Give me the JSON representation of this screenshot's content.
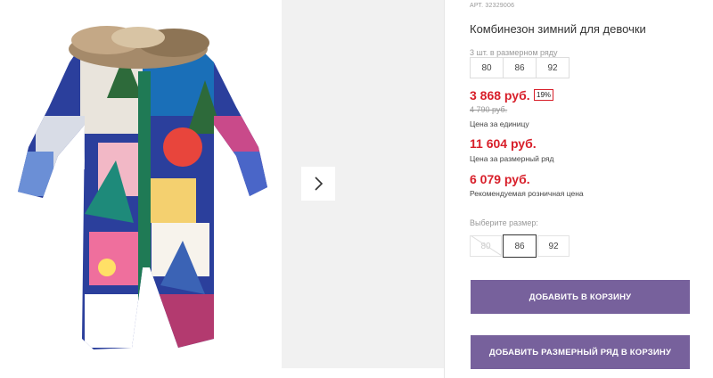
{
  "product": {
    "sku": "АРТ. 32329006",
    "title": "Комбинезон зимний для девочки",
    "image_alt": "Детский зимний комбинезон с меховой опушкой и разноцветным рисунком"
  },
  "size_range": {
    "label": "3 шт. в размерном ряду",
    "sizes": [
      "80",
      "86",
      "92"
    ]
  },
  "pricing": {
    "unit_price": "3 868 руб.",
    "discount": "19%",
    "old_price": "4 790 руб.",
    "unit_caption": "Цена за единицу",
    "range_price": "11 604 руб.",
    "range_caption": "Цена за размерный ряд",
    "retail_price": "6 079 руб.",
    "retail_caption": "Рекомендуемая розничная цена",
    "accent_color": "#d81f2a"
  },
  "size_select": {
    "label": "Выберите размер:",
    "options": [
      {
        "label": "80",
        "state": "disabled"
      },
      {
        "label": "86",
        "state": "selected"
      },
      {
        "label": "92",
        "state": "available"
      }
    ]
  },
  "actions": {
    "add_to_cart": "ДОБАВИТЬ В КОРЗИНУ",
    "add_range_to_cart": "ДОБАВИТЬ РАЗМЕРНЫЙ РЯД В КОРЗИНУ",
    "button_color": "#77619c"
  },
  "gallery": {
    "next_icon": "chevron-right-icon"
  }
}
